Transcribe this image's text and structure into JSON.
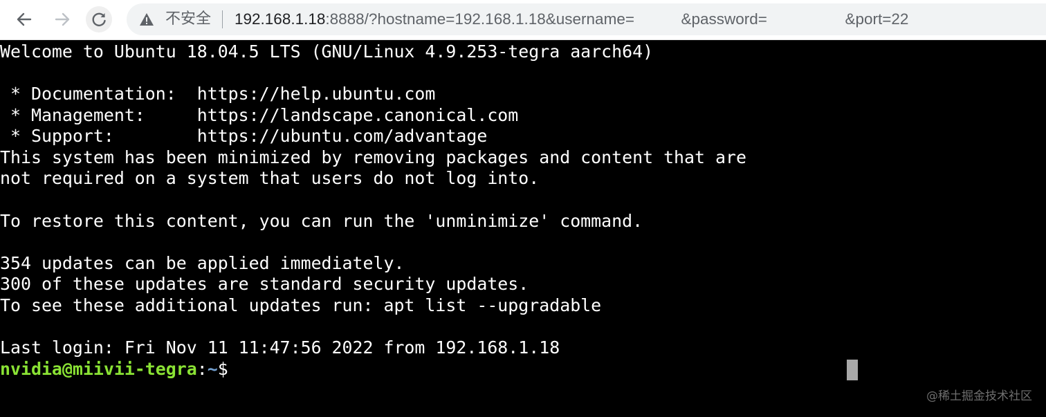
{
  "browser": {
    "nav": {
      "back_icon": "arrow-left-icon",
      "forward_icon": "arrow-right-icon",
      "reload_icon": "reload-icon"
    },
    "omnibox": {
      "security_icon": "warning-triangle-icon",
      "security_label": "不安全",
      "url_host": "192.168.1.18",
      "url_rest": ":8888/?hostname=192.168.1.18&username=",
      "url_masked_1": "   ",
      "url_mid": "&password=",
      "url_masked_2": "     ",
      "url_tail": "&port=22"
    }
  },
  "terminal": {
    "lines": [
      "Welcome to Ubuntu 18.04.5 LTS (GNU/Linux 4.9.253-tegra aarch64)",
      "",
      " * Documentation:  https://help.ubuntu.com",
      " * Management:     https://landscape.canonical.com",
      " * Support:        https://ubuntu.com/advantage",
      "This system has been minimized by removing packages and content that are",
      "not required on a system that users do not log into.",
      "",
      "To restore this content, you can run the 'unminimize' command.",
      "",
      "354 updates can be applied immediately.",
      "300 of these updates are standard security updates.",
      "To see these additional updates run: apt list --upgradable",
      "",
      "Last login: Fri Nov 11 11:47:56 2022 from 192.168.1.18"
    ],
    "prompt": {
      "user_host": "nvidia@miivii-tegra",
      "colon": ":",
      "path": "~",
      "symbol": "$"
    }
  },
  "watermark": "@稀土掘金技术社区",
  "colors": {
    "terminal_bg": "#000000",
    "terminal_fg": "#ffffff",
    "prompt_user": "#8ae234",
    "prompt_path": "#729fcf",
    "cursor": "#a8a8a8"
  }
}
